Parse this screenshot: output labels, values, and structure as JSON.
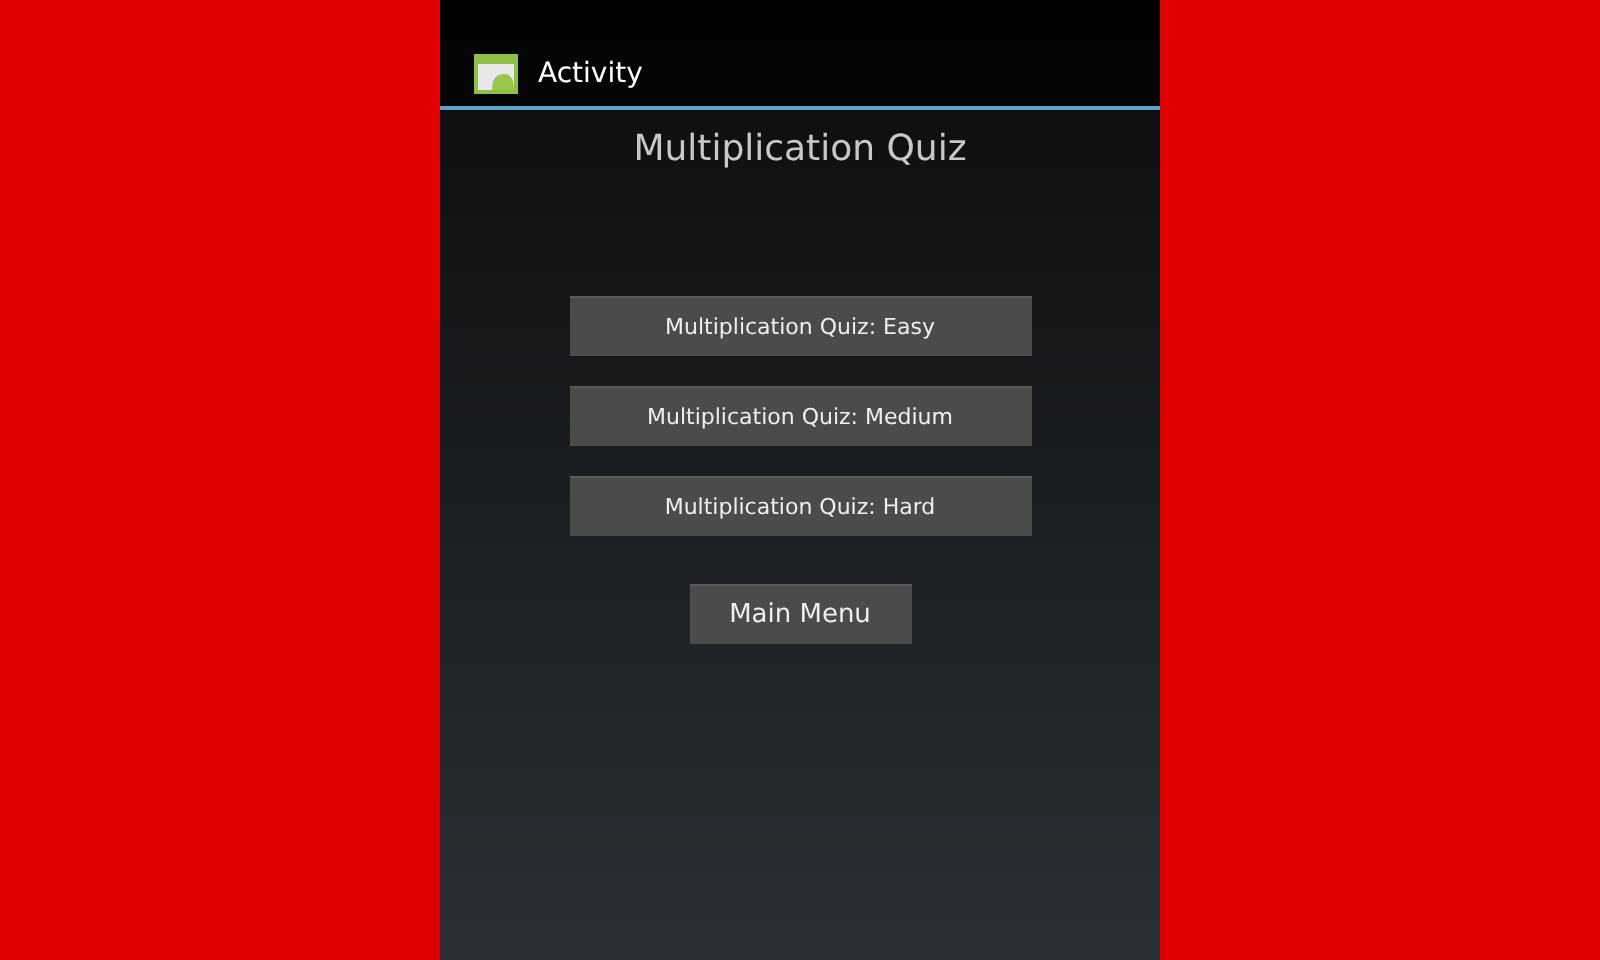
{
  "action_bar": {
    "title": "Activity"
  },
  "heading": "Multiplication Quiz",
  "quiz_buttons": [
    "Multiplication Quiz: Easy",
    "Multiplication Quiz: Medium",
    "Multiplication Quiz: Hard"
  ],
  "main_menu_button": "Main Menu"
}
